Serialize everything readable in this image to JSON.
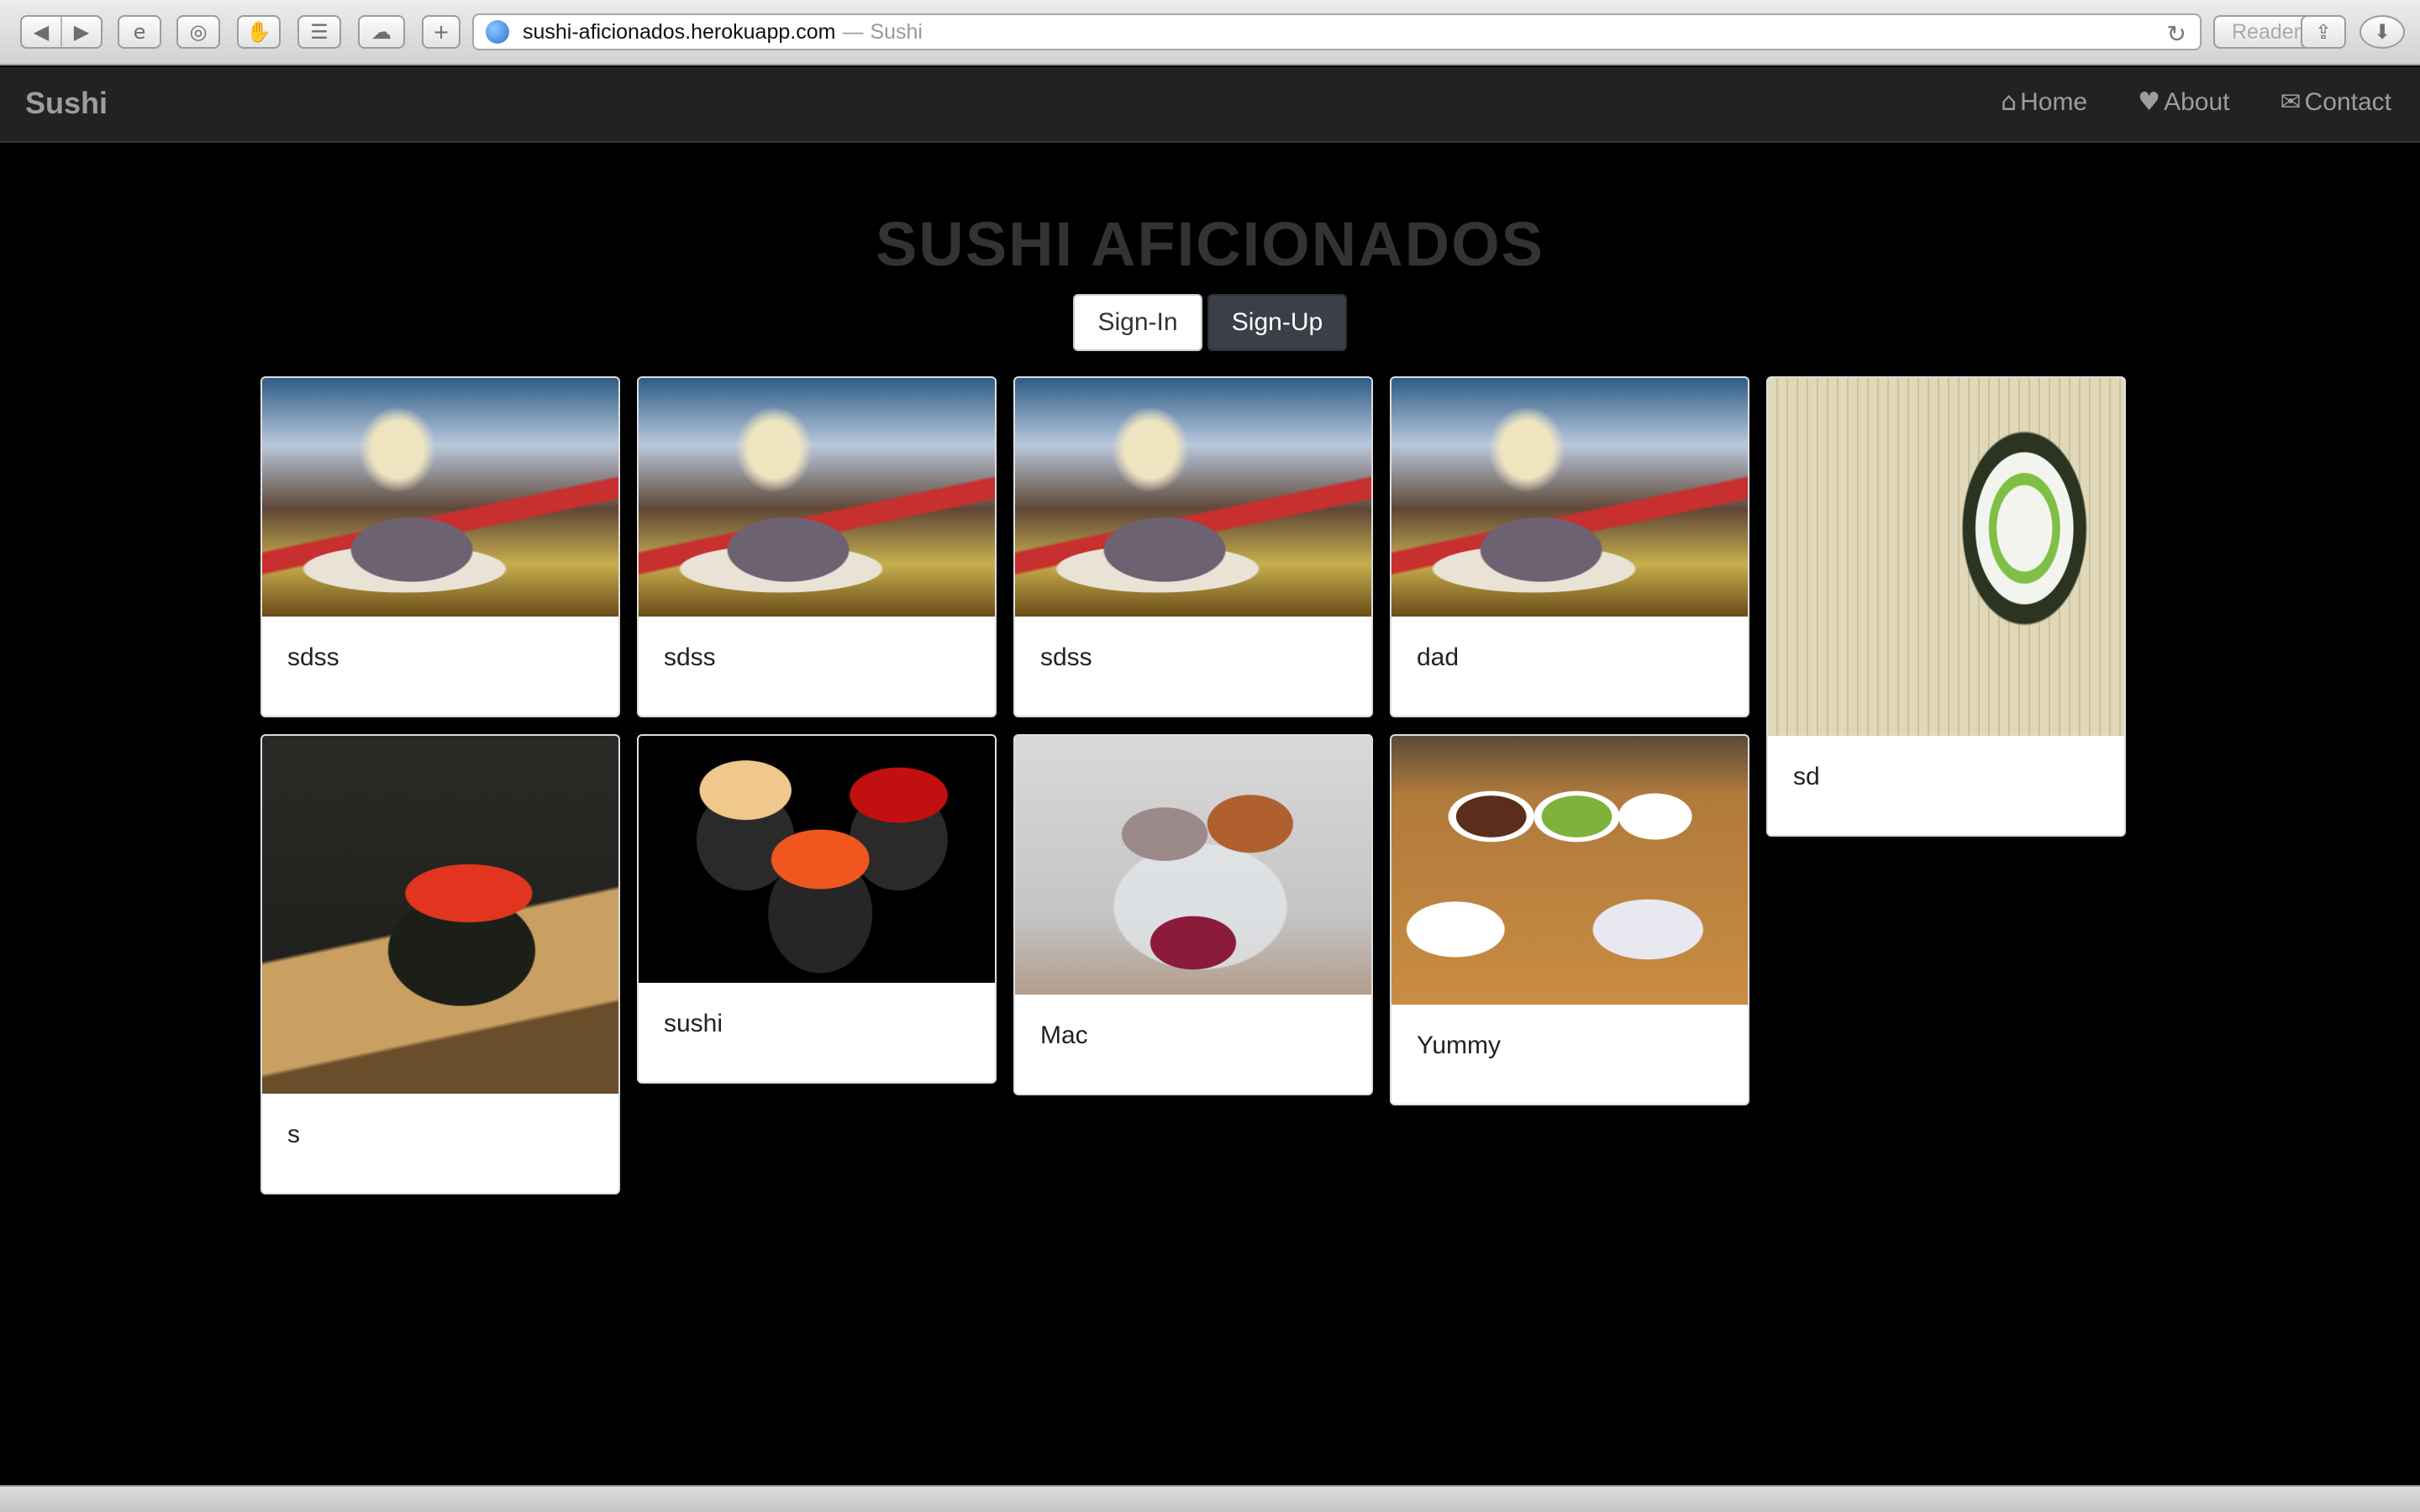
{
  "browser": {
    "url_host": "sushi-aficionados.herokuapp.com",
    "url_separator": "—",
    "page_title": "Sushi",
    "reader_label": "Reader",
    "icons": [
      "back-icon",
      "forward-icon",
      "internet-explorer-icon",
      "compass-icon",
      "evernote-icon",
      "layers-icon",
      "cloud-icon",
      "plus-icon",
      "globe-icon",
      "reload-icon",
      "share-icon",
      "download-icon"
    ]
  },
  "navbar": {
    "brand": "Sushi",
    "links": [
      {
        "label": "Home",
        "icon": "home-icon"
      },
      {
        "label": "About",
        "icon": "heart-icon"
      },
      {
        "label": "Contact",
        "icon": "envelope-icon"
      }
    ]
  },
  "hero": {
    "title": "SUSHI AFICIONADOS",
    "sign_in": "Sign-In",
    "sign_up": "Sign-Up"
  },
  "cards": [
    {
      "caption": "sdss",
      "image": "restaurant-photo"
    },
    {
      "caption": "sdss",
      "image": "restaurant-photo"
    },
    {
      "caption": "sdss",
      "image": "restaurant-photo"
    },
    {
      "caption": "dad",
      "image": "restaurant-photo"
    },
    {
      "caption": "sd",
      "image": "sushi-roll-photo"
    },
    {
      "caption": "s",
      "image": "gunkan-painting"
    },
    {
      "caption": "sushi",
      "image": "ikura-sushi-photo"
    },
    {
      "caption": "Mac",
      "image": "macarons-painting"
    },
    {
      "caption": "Yummy",
      "image": "dinner-table-photo"
    }
  ]
}
